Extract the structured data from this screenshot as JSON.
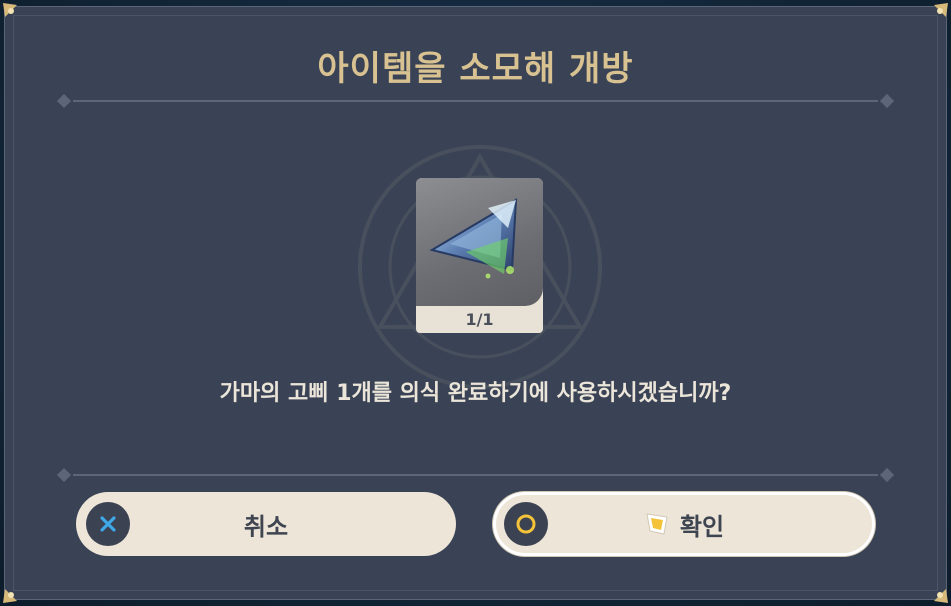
{
  "dialog": {
    "title": "아이템을 소모해 개방",
    "item": {
      "name_icon": "prism-crystal-icon",
      "count": "1/1"
    },
    "message": "가마의 고삐 1개를 의식 완료하기에 사용하시겠습니까?"
  },
  "buttons": {
    "cancel": {
      "label": "취소",
      "icon": "cross-icon"
    },
    "confirm": {
      "label": "확인",
      "icon": "circle-icon",
      "extra_icon": "star-icon"
    }
  },
  "colors": {
    "panel": "#3a4355",
    "title": "#d9c291",
    "button_bg": "#ece5d8",
    "cross_accent": "#3fa9e8",
    "circle_accent": "#f4c33a"
  }
}
